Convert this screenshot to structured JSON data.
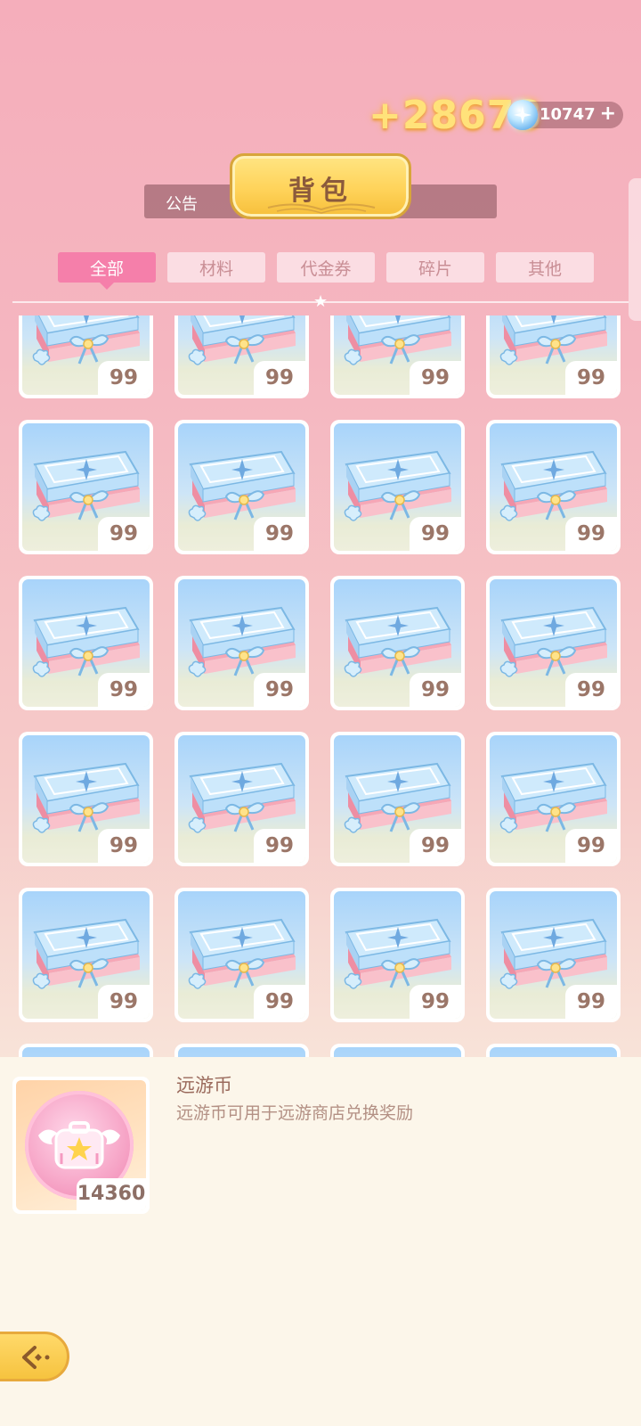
{
  "header": {
    "reward_gain": "+28673",
    "currency_value": "10747",
    "title": "背包",
    "notice_label": "公告"
  },
  "tabs": [
    {
      "label": "全部",
      "active": true
    },
    {
      "label": "材料",
      "active": false
    },
    {
      "label": "代金券",
      "active": false
    },
    {
      "label": "碎片",
      "active": false
    },
    {
      "label": "其他",
      "active": false
    }
  ],
  "grid": {
    "item_icon": "gift-box-icon",
    "items": [
      {
        "qty": "99"
      },
      {
        "qty": "99"
      },
      {
        "qty": "99"
      },
      {
        "qty": "99"
      },
      {
        "qty": "99"
      },
      {
        "qty": "99"
      },
      {
        "qty": "99"
      },
      {
        "qty": "99"
      },
      {
        "qty": "99"
      },
      {
        "qty": "99"
      },
      {
        "qty": "99"
      },
      {
        "qty": "99"
      },
      {
        "qty": "99"
      },
      {
        "qty": "99"
      },
      {
        "qty": "99"
      },
      {
        "qty": "99"
      },
      {
        "qty": "99"
      },
      {
        "qty": "99"
      },
      {
        "qty": "99"
      },
      {
        "qty": "99"
      },
      {
        "qty": ""
      },
      {
        "qty": ""
      },
      {
        "qty": ""
      },
      {
        "qty": ""
      }
    ]
  },
  "detail": {
    "icon": "expedition-coin-icon",
    "qty": "14360",
    "name": "远游币",
    "description": "远游币可用于远游商店兑换奖励"
  },
  "colors": {
    "accent": "#f57faa",
    "tab_bg": "#fbdde3",
    "gold": "#ffd35a",
    "panel_bg": "#fcf6ea"
  }
}
